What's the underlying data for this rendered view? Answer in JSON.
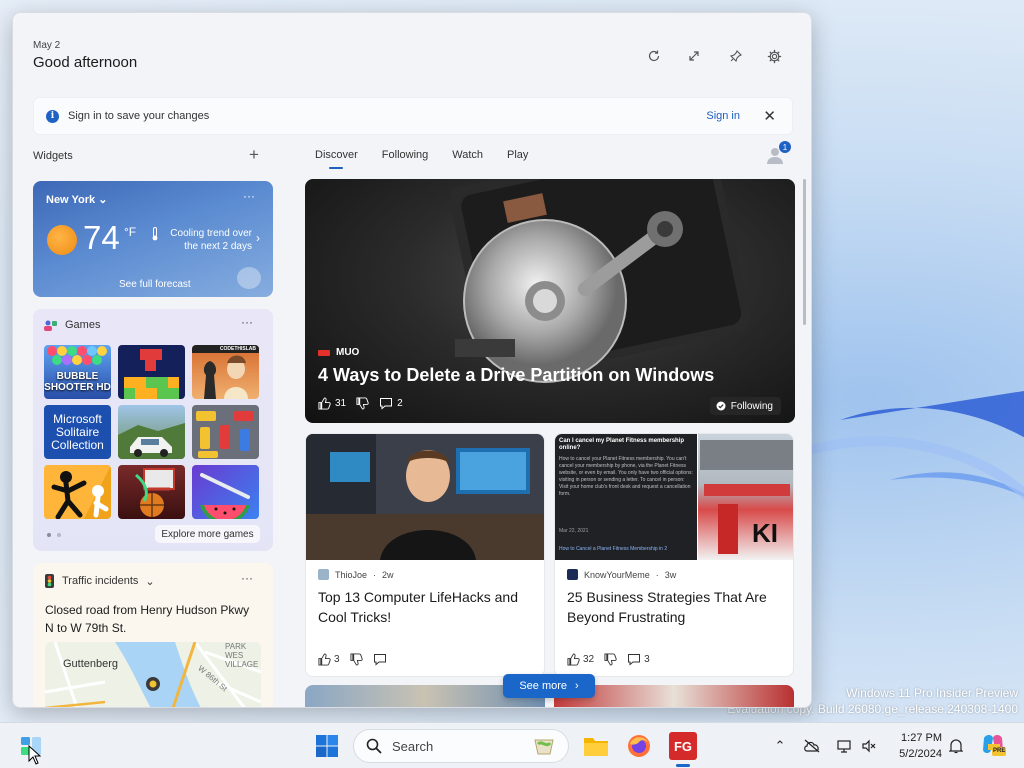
{
  "header": {
    "date": "May 2",
    "greeting": "Good afternoon"
  },
  "signin_bar": {
    "message": "Sign in to save your changes",
    "signin_label": "Sign in"
  },
  "widgets_label": "Widgets",
  "tabs": [
    {
      "label": "Discover",
      "active": true
    },
    {
      "label": "Following",
      "active": false
    },
    {
      "label": "Watch",
      "active": false
    },
    {
      "label": "Play",
      "active": false
    }
  ],
  "notification_count": "1",
  "weather": {
    "city": "New York",
    "temperature": "74",
    "unit": "°F",
    "trend": "Cooling trend over the next 2 days",
    "forecast_link": "See full forecast"
  },
  "games": {
    "title": "Games",
    "tiles": [
      "BUBBLE SHOOTER",
      "Block puzzle",
      "CODETHISLAB",
      "Microsoft Solitaire Collection",
      "Car racing",
      "Parking jam",
      "Stickman fight",
      "Basketball",
      "Fruit slice"
    ],
    "tile_texts": {
      "bubble": "BUBBLE SHOOTER",
      "bubble_sub": "HD",
      "codethislab": "CODETHISLAB",
      "solitaire": "Microsoft Solitaire Collection"
    },
    "explore_label": "Explore more games"
  },
  "traffic": {
    "title": "Traffic incidents",
    "description": "Closed road from Henry Hudson Pkwy N to W 79th St.",
    "map_labels": {
      "town": "Guttenberg",
      "district": "PARK WES VILLAGE",
      "street": "W 86th St"
    }
  },
  "hero": {
    "source": "MUO",
    "title": "4 Ways to Delete a Drive Partition on Windows",
    "likes": "31",
    "comments": "2",
    "following_label": "Following"
  },
  "cards": [
    {
      "source": "ThioJoe",
      "age": "2w",
      "title": "Top 13 Computer LifeHacks and Cool Tricks!",
      "likes": "3",
      "comments": ""
    },
    {
      "source": "KnowYourMeme",
      "age": "3w",
      "title": "25 Business Strategies That Are Beyond Frustrating",
      "likes": "32",
      "comments": "3",
      "image_text": {
        "q": "Can I cancel my Planet Fitness membership online?",
        "body": "How to cancel your Planet Fitness membership. You can't cancel your membership by phone, via the Planet Fitness website, or even by email. You only have two official options: visiting in person or sending a letter. To cancel in person: Visit your home club's front desk and request a cancellation form.",
        "date": "Mar 22, 2021",
        "link": "How to Cancel a Planet Fitness Membership in 2",
        "sign": "KI"
      }
    }
  ],
  "see_more_label": "See more",
  "taskbar": {
    "search_placeholder": "Search",
    "time": "1:27 PM",
    "date": "5/2/2024",
    "fg_label": "FG",
    "pre_label": "PRE"
  },
  "watermark": {
    "line1": "Windows 11 Pro Insider Preview",
    "line2": "Evaluation copy. Build 26080.ge_release.240308-1400"
  },
  "colors": {
    "accent": "#1a66c9",
    "weather_card": "#4a78c2",
    "games_card": "#e6e6f7",
    "traffic_card": "#fbf7ef"
  }
}
